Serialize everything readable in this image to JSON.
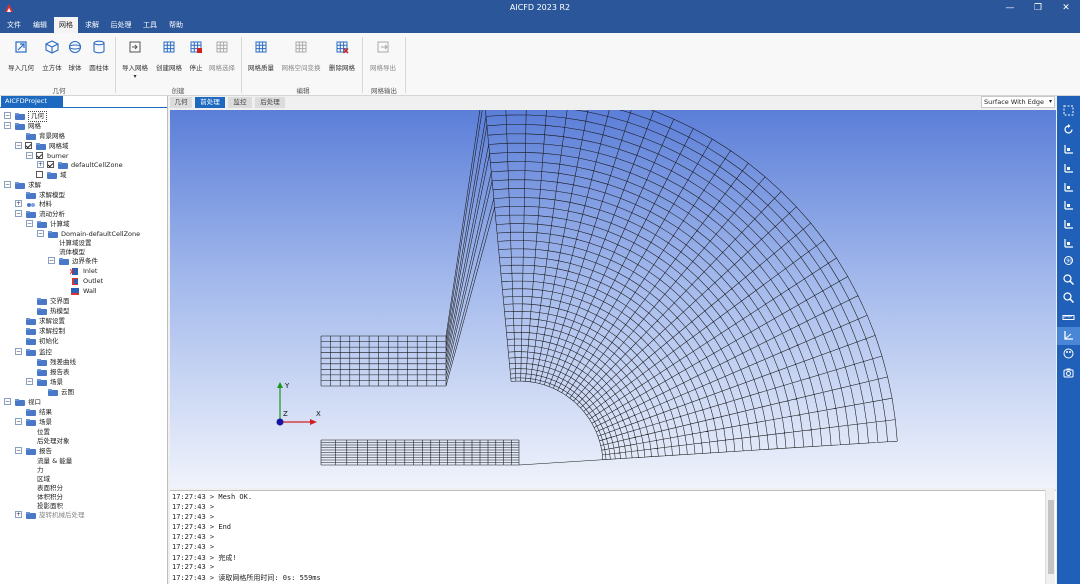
{
  "window": {
    "title": "AICFD 2023 R2",
    "controls": [
      "—",
      "❐",
      "✕"
    ]
  },
  "menu": [
    "文件",
    "编辑",
    "网格",
    "求解",
    "后处理",
    "工具",
    "帮助"
  ],
  "ribbon": {
    "buttons": [
      "导入几何",
      "立方体",
      "球体",
      "圆柱体",
      "导入网格",
      "创建网格",
      "停止",
      "网格选择",
      "网格质量",
      "网格空间变换",
      "删除网格",
      "网格导出"
    ],
    "groups": [
      "几何",
      "创建",
      "编辑",
      "网格输出"
    ]
  },
  "tree": {
    "tab": "AICFDProject",
    "nodes": [
      "几何",
      "网格",
      "背景网格",
      "网格域",
      "burner",
      "defaultCellZone",
      "域",
      "求解",
      "求解模型",
      "材料",
      "流动分析",
      "计算域",
      "Domain-defaultCellZone",
      "计算域设置",
      "流体模型",
      "边界条件",
      "Inlet",
      "Outlet",
      "Wall",
      "交界面",
      "热模型",
      "求解设置",
      "求解控制",
      "初始化",
      "监控",
      "残差曲线",
      "报告表",
      "场景",
      "云图",
      "视口",
      "结果",
      "场景",
      "位置",
      "后处理对象",
      "报告",
      "流量 & 能量",
      "力",
      "区域",
      "表面积分",
      "体积积分",
      "投影面积",
      "旋转机械后处理"
    ]
  },
  "view_tabs": [
    "几何",
    "前处理",
    "监控",
    "后处理"
  ],
  "view_mode": "Surface With Edge",
  "axes": {
    "y": "Y",
    "x": "X",
    "z": "Z"
  },
  "console": [
    "17:27:43 > Mesh OK.",
    "17:27:43 >",
    "17:27:43 >",
    "17:27:43 > End",
    "17:27:43 >",
    "17:27:43 >",
    "17:27:43 > 完成!",
    "17:27:43 >",
    "17:27:43 > 读取网格所用时间: 0s: 559ms"
  ],
  "colors": {
    "titlebar": "#2b579a",
    "accent": "#1e69c0",
    "rightbar": "#2060b8"
  },
  "right_toolbar_icons": [
    "fit-view-icon",
    "rotate-icon",
    "axis-view-x-icon",
    "axis-view-neg-x-icon",
    "axis-view-y-icon",
    "axis-view-neg-y-icon",
    "axis-view-z-icon",
    "axis-view-neg-z-icon",
    "rotate-90-icon",
    "zoom-box-icon",
    "zoom-region-icon",
    "ruler-icon",
    "axes-toggle-icon",
    "color-palette-icon",
    "camera-icon"
  ]
}
